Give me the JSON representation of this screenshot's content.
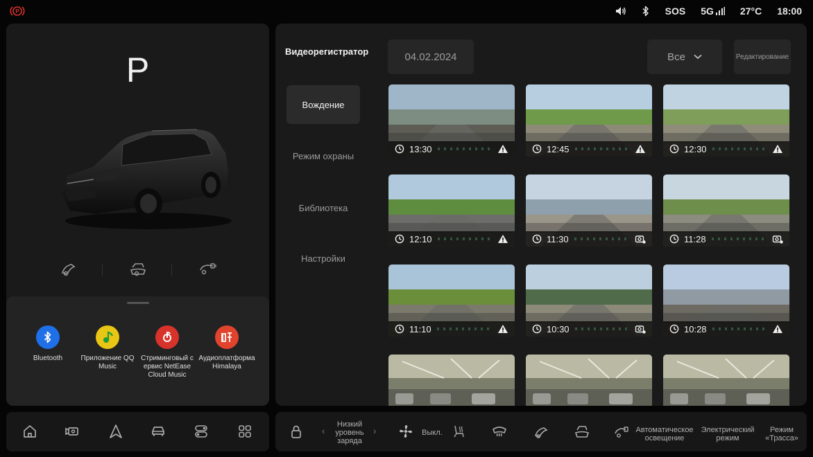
{
  "status_bar": {
    "sos": "SOS",
    "network": "5G",
    "temperature": "27°C",
    "time": "18:00",
    "icons": [
      "parking-brake-warning-icon",
      "volume-icon",
      "bluetooth-icon",
      "signal-icon"
    ]
  },
  "vehicle": {
    "gear": "P"
  },
  "apps": [
    {
      "label": "Bluetooth",
      "icon": "bluetooth-icon",
      "color": "#1f6fe8"
    },
    {
      "label": "Приложение QQ Music",
      "icon": "qq-music-icon",
      "color": "#e9c514"
    },
    {
      "label": "Стриминговый с ервис NetEase Cloud Music",
      "icon": "netease-music-icon",
      "color": "#d8332b"
    },
    {
      "label": "Аудиоплатформа Himalaya",
      "icon": "himalaya-icon",
      "color": "#e2432d"
    }
  ],
  "recorder": {
    "title": "Видеорегистратор",
    "nav": [
      {
        "label": "Вождение",
        "active": true
      },
      {
        "label": "Режим охраны",
        "active": false
      },
      {
        "label": "Библиотека",
        "active": false
      },
      {
        "label": "Настройки",
        "active": false
      }
    ],
    "date": "04.02.2024",
    "filter": "Все",
    "edit_label": "Редактирование",
    "clips": [
      {
        "time": "13:30",
        "type": "warning-icon"
      },
      {
        "time": "12:45",
        "type": "warning-icon"
      },
      {
        "time": "12:30",
        "type": "warning-icon"
      },
      {
        "time": "12:10",
        "type": "warning-icon"
      },
      {
        "time": "11:30",
        "type": "photo-icon"
      },
      {
        "time": "11:28",
        "type": "photo-icon"
      },
      {
        "time": "11:10",
        "type": "warning-icon"
      },
      {
        "time": "10:30",
        "type": "photo-icon"
      },
      {
        "time": "10:28",
        "type": "warning-icon"
      },
      {
        "time": "",
        "type": ""
      },
      {
        "time": "",
        "type": ""
      },
      {
        "time": "",
        "type": ""
      }
    ]
  },
  "dock": {
    "battery_label": "Низкий уровень заряда",
    "fan_label": "Выкл.",
    "auto_light_label": "Автоматическое освещение",
    "electric_label": "Электрический режим",
    "highway_label": "Режим «Трасса»"
  },
  "colors": {
    "panel": "#1a1a1a",
    "active_nav": "#2b2b2b",
    "field": "#262626",
    "warning": "#d8332b"
  }
}
